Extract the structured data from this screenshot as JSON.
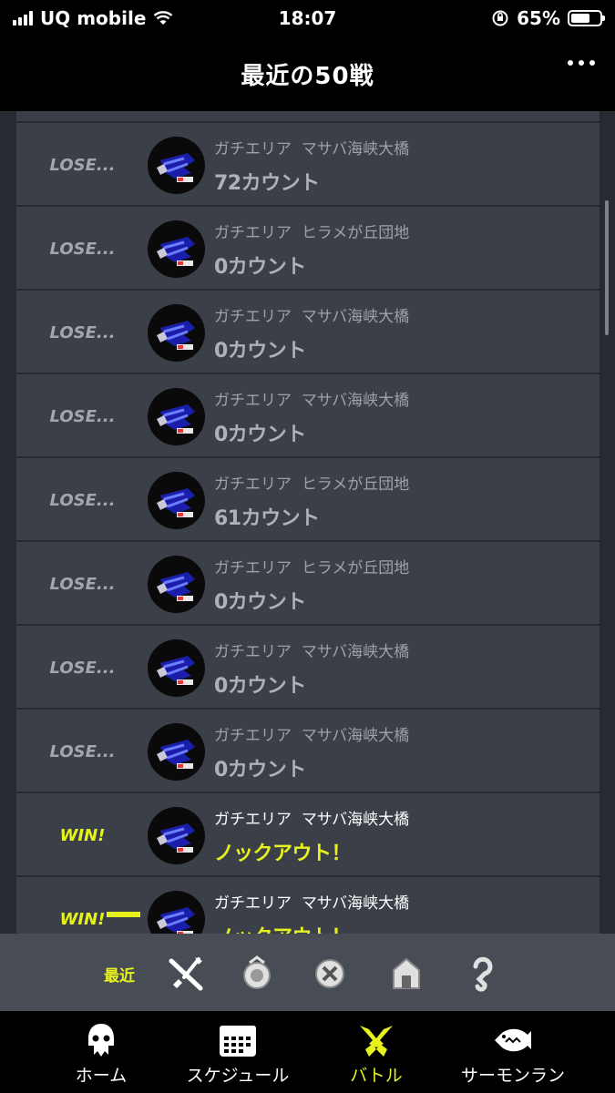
{
  "status_bar": {
    "carrier": "UQ mobile",
    "time": "18:07",
    "battery": "65%",
    "battery_level": 0.65
  },
  "header": {
    "title": "最近の50戦"
  },
  "battles": [
    {
      "result": "LOSE...",
      "mode": "ガチエリア",
      "stage": "マサバ海峡大橋",
      "outcome": "72カウント",
      "is_win": false
    },
    {
      "result": "LOSE...",
      "mode": "ガチエリア",
      "stage": "ヒラメが丘団地",
      "outcome": "0カウント",
      "is_win": false
    },
    {
      "result": "LOSE...",
      "mode": "ガチエリア",
      "stage": "マサバ海峡大橋",
      "outcome": "0カウント",
      "is_win": false
    },
    {
      "result": "LOSE...",
      "mode": "ガチエリア",
      "stage": "マサバ海峡大橋",
      "outcome": "0カウント",
      "is_win": false
    },
    {
      "result": "LOSE...",
      "mode": "ガチエリア",
      "stage": "ヒラメが丘団地",
      "outcome": "61カウント",
      "is_win": false
    },
    {
      "result": "LOSE...",
      "mode": "ガチエリア",
      "stage": "ヒラメが丘団地",
      "outcome": "0カウント",
      "is_win": false
    },
    {
      "result": "LOSE...",
      "mode": "ガチエリア",
      "stage": "マサバ海峡大橋",
      "outcome": "0カウント",
      "is_win": false
    },
    {
      "result": "LOSE...",
      "mode": "ガチエリア",
      "stage": "マサバ海峡大橋",
      "outcome": "0カウント",
      "is_win": false
    },
    {
      "result": "WIN!",
      "mode": "ガチエリア",
      "stage": "マサバ海峡大橋",
      "outcome": "ノックアウト！",
      "is_win": true
    },
    {
      "result": "WIN!",
      "mode": "ガチエリア",
      "stage": "マサバ海峡大橋",
      "outcome": "ノックアウト！",
      "is_win": true
    }
  ],
  "filter_bar": {
    "active_label": "最近",
    "icons": [
      "regular-battle-icon",
      "ranked-battle-icon",
      "x-battle-icon",
      "private-battle-icon",
      "fest-battle-icon"
    ]
  },
  "bottom_nav": {
    "items": [
      {
        "label": "ホーム",
        "icon": "squid-icon"
      },
      {
        "label": "スケジュール",
        "icon": "calendar-icon"
      },
      {
        "label": "バトル",
        "icon": "battle-icon"
      },
      {
        "label": "サーモンラン",
        "icon": "salmon-icon"
      }
    ],
    "active_index": 2
  },
  "colors": {
    "accent": "#e7f21c",
    "row_bg": "#3b4048",
    "content_bg": "#262a31",
    "filter_bg": "#474c55"
  }
}
